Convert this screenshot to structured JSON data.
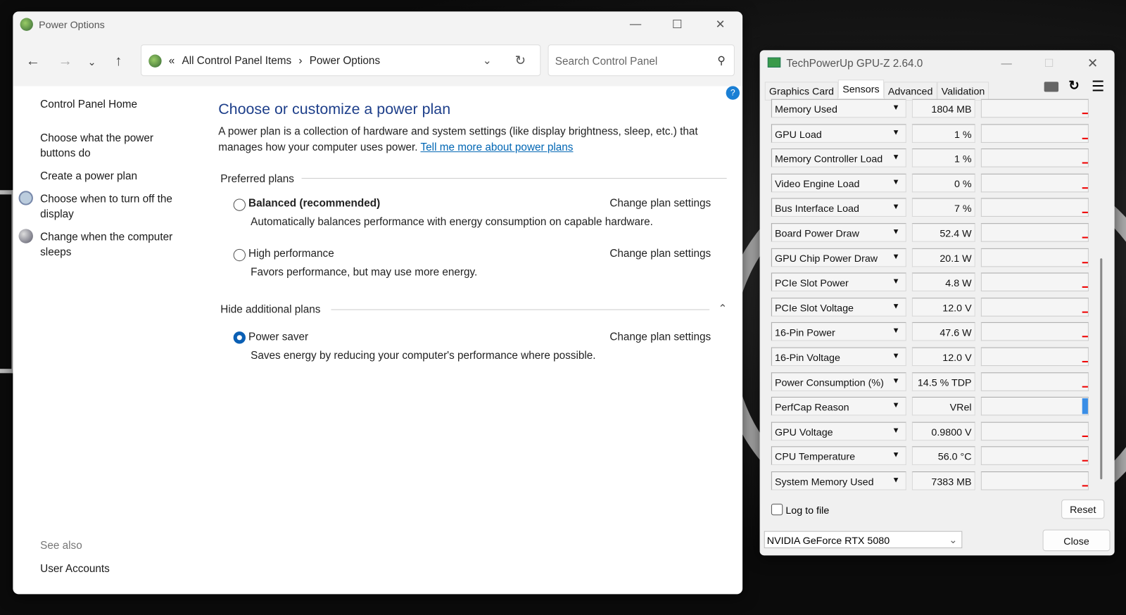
{
  "power_options": {
    "title": "Power Options",
    "breadcrumb": [
      "All Control Panel Items",
      "Power Options"
    ],
    "breadcrumb_prefix": "«",
    "search_placeholder": "Search Control Panel",
    "sidebar": {
      "home": "Control Panel Home",
      "links": [
        "Choose what the power buttons do",
        "Create a power plan",
        "Choose when to turn off the display",
        "Change when the computer sleeps"
      ],
      "see_also": "See also",
      "user_accounts": "User Accounts"
    },
    "heading": "Choose or customize a power plan",
    "description": "A power plan is a collection of hardware and system settings (like display brightness, sleep, etc.) that manages how your computer uses power.",
    "learn_more": "Tell me more about power plans",
    "preferred_label": "Preferred plans",
    "hide_label": "Hide additional plans",
    "change_label": "Change plan settings",
    "plans": [
      {
        "name": "Balanced (recommended)",
        "desc": "Automatically balances performance with energy consumption on capable hardware.",
        "selected": false
      },
      {
        "name": "High performance",
        "desc": "Favors performance, but may use more energy.",
        "selected": false
      },
      {
        "name": "Power saver",
        "desc": "Saves energy by reducing your computer's performance where possible.",
        "selected": true
      }
    ]
  },
  "gpuz": {
    "title": "TechPowerUp GPU-Z 2.64.0",
    "tabs": [
      "Graphics Card",
      "Sensors",
      "Advanced",
      "Validation"
    ],
    "active_tab": "Sensors",
    "sensors": [
      {
        "name": "Memory Used",
        "value": "1804 MB"
      },
      {
        "name": "GPU Load",
        "value": "1 %"
      },
      {
        "name": "Memory Controller Load",
        "value": "1 %"
      },
      {
        "name": "Video Engine Load",
        "value": "0 %"
      },
      {
        "name": "Bus Interface Load",
        "value": "7 %"
      },
      {
        "name": "Board Power Draw",
        "value": "52.4 W"
      },
      {
        "name": "GPU Chip Power Draw",
        "value": "20.1 W"
      },
      {
        "name": "PCIe Slot Power",
        "value": "4.8 W"
      },
      {
        "name": "PCIe Slot Voltage",
        "value": "12.0 V"
      },
      {
        "name": "16-Pin Power",
        "value": "47.6 W"
      },
      {
        "name": "16-Pin Voltage",
        "value": "12.0 V"
      },
      {
        "name": "Power Consumption (%)",
        "value": "14.5 % TDP"
      },
      {
        "name": "PerfCap Reason",
        "value": "VRel"
      },
      {
        "name": "GPU Voltage",
        "value": "0.9800 V"
      },
      {
        "name": "CPU Temperature",
        "value": "56.0 °C"
      },
      {
        "name": "System Memory Used",
        "value": "7383 MB"
      }
    ],
    "log_to_file": "Log to file",
    "reset": "Reset",
    "close": "Close",
    "gpu_select": "NVIDIA GeForce RTX 5080"
  }
}
